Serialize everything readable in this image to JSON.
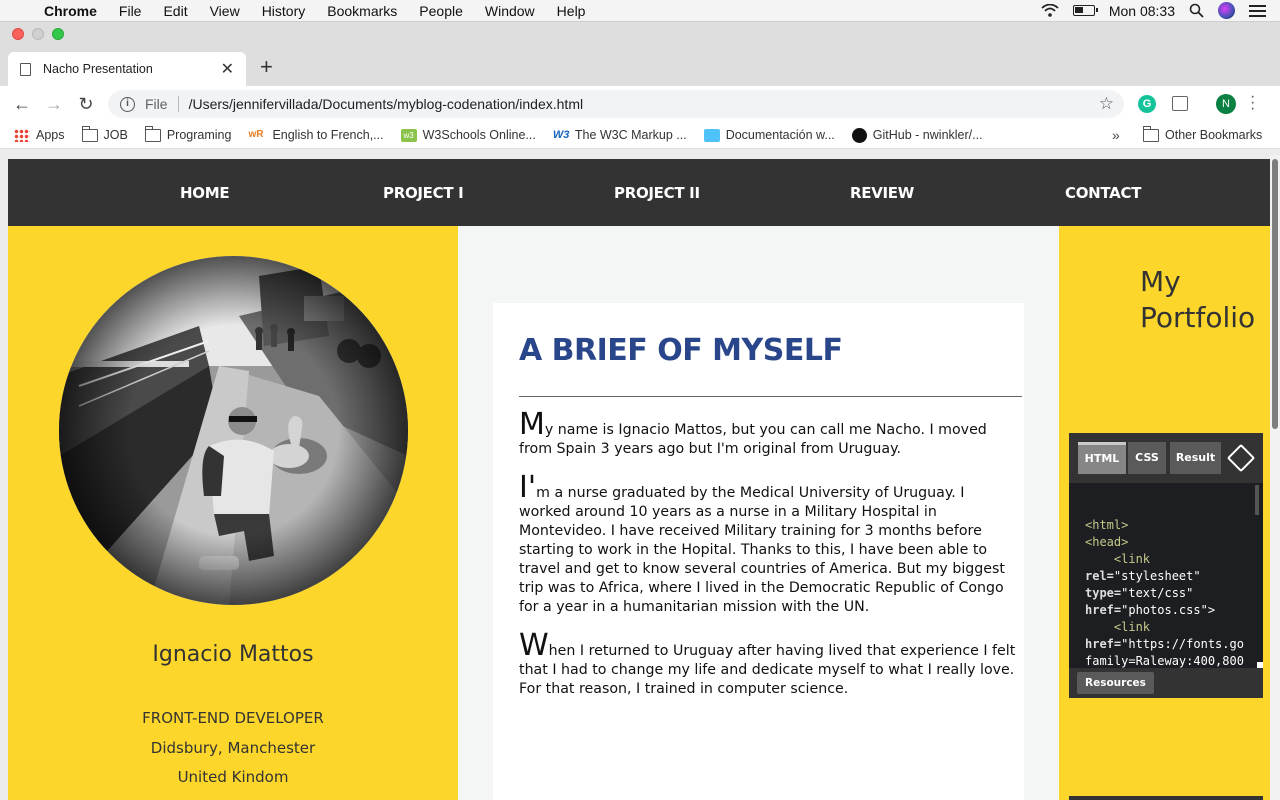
{
  "menubar": {
    "app_name": "Chrome",
    "items": [
      "File",
      "Edit",
      "View",
      "History",
      "Bookmarks",
      "People",
      "Window",
      "Help"
    ],
    "clock": "Mon 08:33"
  },
  "tab": {
    "title": "Nacho Presentation"
  },
  "omnibox": {
    "scheme_label": "File",
    "url": "/Users/jennifervillada/Documents/myblog-codenation/index.html"
  },
  "profile": {
    "initial": "N"
  },
  "bookmarks": {
    "items": [
      {
        "label": "Apps",
        "icon": "apps-icon"
      },
      {
        "label": "JOB",
        "icon": "folder-icon"
      },
      {
        "label": "Programing",
        "icon": "folder-icon"
      },
      {
        "label": "English to French,...",
        "icon": "wordreference-icon"
      },
      {
        "label": "W3Schools Online...",
        "icon": "w3schools-icon"
      },
      {
        "label": "The W3C Markup ...",
        "icon": "w3c-icon"
      },
      {
        "label": "Documentación w...",
        "icon": "doc-favicon"
      },
      {
        "label": "GitHub - nwinkler/...",
        "icon": "github-icon"
      }
    ],
    "more": "»",
    "other": "Other Bookmarks"
  },
  "site": {
    "nav": [
      "HOME",
      "PROJECT I",
      "PROJECT II",
      "REVIEW",
      "CONTACT"
    ],
    "profile_name": "Ignacio Mattos",
    "role": "FRONT-END DEVELOPER",
    "location1": "Didsbury, Manchester",
    "location2": "United Kindom",
    "article_title": "A BRIEF OF MYSELF",
    "paragraphs": [
      {
        "initial": "M",
        "rest": "y name is Ignacio Mattos, but you can call me Nacho. I moved from Spain 3 years ago but I'm original from Uruguay."
      },
      {
        "initial": "I'",
        "rest": "m a nurse graduated by the Medical University of Uruguay. I worked around 10 years as a nurse in a Military Hospital in Montevideo. I have received Military training for 3 months before starting to work in the Hopital. Thanks to this, I have been able to travel and get to know several countries of America. But my biggest trip was to Africa, where I lived in the Democratic Republic of Congo for a year in a humanitarian mission with the UN."
      },
      {
        "initial": "W",
        "rest": "hen I returned to Uruguay after having lived that experience I felt that I had to change my life and dedicate myself to what I really love. For that reason, I trained in computer science."
      }
    ],
    "portfolio_title_line1": "My",
    "portfolio_title_line2": "Portfolio"
  },
  "codepen": {
    "tabs": [
      "HTML",
      "CSS",
      "Result"
    ],
    "resources": "Resources",
    "code": {
      "l1": "<html>",
      "l2": "<head>",
      "l3": "<link",
      "l4_attr": "rel=",
      "l4_val": "\"stylesheet\"",
      "l5_attr": "type=",
      "l5_val": "\"text/css\"",
      "l6_attr": "href=",
      "l6_val": "\"photos.css\">",
      "l7": "<link",
      "l8_attr": "href=",
      "l8_val": "\"https://fonts.go",
      "l9": "family=Raleway:400,800"
    }
  },
  "colors": {
    "yellow": "#fcd62b",
    "nav_bg": "#333333",
    "title_blue": "#2a468b"
  }
}
